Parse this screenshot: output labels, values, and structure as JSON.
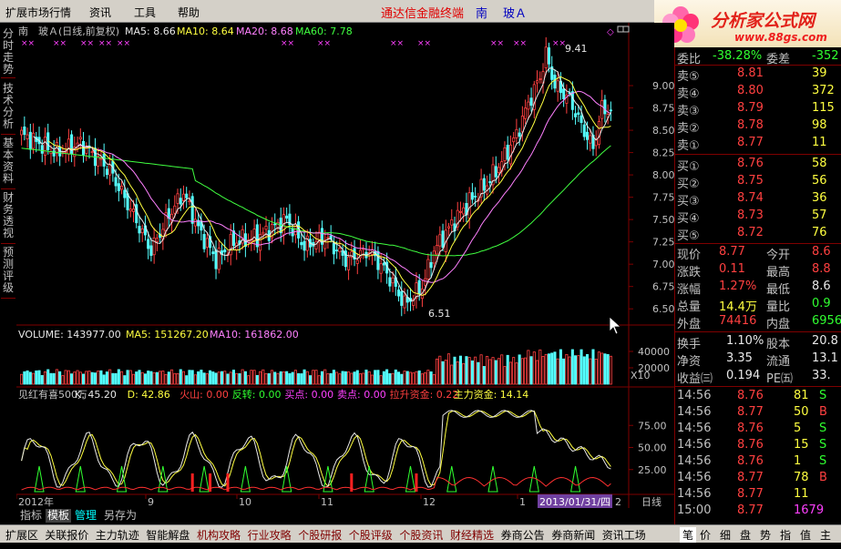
{
  "menubar": {
    "items": [
      "扩展市场行情",
      "资讯",
      "工具",
      "帮助"
    ],
    "title_main": "通达信金融终端",
    "title_market": "南",
    "title_stock": "玻Ａ",
    "window_controls": [
      "_",
      "□",
      "×"
    ]
  },
  "logo": {
    "text": "分析家公式网",
    "url": "www.88gs.com"
  },
  "left_tabs": [
    "分时走势",
    "技术分析",
    "基本资料",
    "财务透视",
    "预测评级"
  ],
  "main_chart": {
    "title": "南　玻Ａ(日线,前复权)",
    "ma": [
      {
        "label": "MA5: 8.66",
        "color": "#e8e8e8"
      },
      {
        "label": "MA10: 8.64",
        "color": "#ffff40"
      },
      {
        "label": "MA20: 8.68",
        "color": "#ff80ff"
      },
      {
        "label": "MA60: 7.78",
        "color": "#40ff40"
      }
    ],
    "high_label": "9.41",
    "low_label": "6.51",
    "y_ticks": [
      "9.00",
      "8.75",
      "8.50",
      "8.25",
      "8.00",
      "7.75",
      "7.50",
      "7.25",
      "7.00",
      "6.75",
      "6.50"
    ]
  },
  "volume": {
    "label": "VOLUME: 143977.00",
    "ma5": "MA5: 151267.20",
    "ma10": "MA10: 161862.00",
    "y_ticks": [
      "40000",
      "20000"
    ],
    "unit": "X10"
  },
  "indicator": {
    "name": "见红有喜500万",
    "items": [
      {
        "label": "K: 45.20",
        "color": "#e8e8e8"
      },
      {
        "label": "D: 42.86",
        "color": "#ffff40"
      },
      {
        "label": "火山: 0.00",
        "color": "#ff4040"
      },
      {
        "label": "反转: 0.00",
        "color": "#30ff30"
      },
      {
        "label": "买点: 0.00",
        "color": "#ff40ff"
      },
      {
        "label": "卖点: 0.00",
        "color": "#ff40ff"
      },
      {
        "label": "拉升资金: 0.22",
        "color": "#ff4040"
      },
      {
        "label": "主力资金: 14.14",
        "color": "#ffff40"
      }
    ],
    "y_ticks": [
      "75.00",
      "50.00",
      "25.00"
    ]
  },
  "x_axis": {
    "labels": [
      "2012年",
      "9",
      "10",
      "11",
      "12",
      "1"
    ],
    "cursor_date": "2013/01/31/四",
    "last": "2",
    "period": "日线"
  },
  "toolbar1": {
    "items": [
      "指标",
      "模板",
      "管理",
      "另存为"
    ]
  },
  "bottom_tabs": [
    "扩展区",
    "关联报价",
    "主力轨迹",
    "智能解盘",
    "机构攻略",
    "行业攻略",
    "个股研报",
    "个股评级",
    "个股资讯",
    "财经精选",
    "券商公告",
    "券商新闻",
    "资讯工场"
  ],
  "side_tabs": [
    "笔",
    "价",
    "细",
    "盘",
    "势",
    "指",
    "值",
    "主"
  ],
  "quote": {
    "header": {
      "weibi_label": "委比",
      "weibi_value": "-38.28%",
      "weicha_label": "委差",
      "weicha_value": "-352"
    },
    "sells": [
      {
        "label": "卖⑤",
        "price": "8.81",
        "vol": "39"
      },
      {
        "label": "卖④",
        "price": "8.80",
        "vol": "372"
      },
      {
        "label": "卖③",
        "price": "8.79",
        "vol": "115"
      },
      {
        "label": "卖②",
        "price": "8.78",
        "vol": "98"
      },
      {
        "label": "卖①",
        "price": "8.77",
        "vol": "11"
      }
    ],
    "buys": [
      {
        "label": "买①",
        "price": "8.76",
        "vol": "58"
      },
      {
        "label": "买②",
        "price": "8.75",
        "vol": "56"
      },
      {
        "label": "买③",
        "price": "8.74",
        "vol": "36"
      },
      {
        "label": "买④",
        "price": "8.73",
        "vol": "57"
      },
      {
        "label": "买⑤",
        "price": "8.72",
        "vol": "76"
      }
    ],
    "stats": [
      {
        "l1": "现价",
        "v1": "8.77",
        "c1": "red",
        "l2": "今开",
        "v2": "8.6",
        "c2": "red"
      },
      {
        "l1": "涨跌",
        "v1": "0.11",
        "c1": "red",
        "l2": "最高",
        "v2": "8.8",
        "c2": "red"
      },
      {
        "l1": "涨幅",
        "v1": "1.27%",
        "c1": "red",
        "l2": "最低",
        "v2": "8.6",
        "c2": "white"
      },
      {
        "l1": "总量",
        "v1": "14.4万",
        "c1": "yellow",
        "l2": "量比",
        "v2": "0.9",
        "c2": "green"
      },
      {
        "l1": "外盘",
        "v1": "74416",
        "c1": "red",
        "l2": "内盘",
        "v2": "6956",
        "c2": "green"
      }
    ],
    "stats2": [
      {
        "l1": "换手",
        "v1": "1.10%",
        "l2": "股本",
        "v2": "20.8"
      },
      {
        "l1": "净资",
        "v1": "3.35",
        "l2": "流通",
        "v2": "13.1"
      },
      {
        "l1": "收益㈢",
        "v1": "0.194",
        "l2": "PE㈤",
        "v2": "33."
      }
    ],
    "ticks": [
      {
        "time": "14:56",
        "price": "8.76",
        "vol": "81",
        "side": "S",
        "vc": "yellow",
        "sc": "green"
      },
      {
        "time": "14:56",
        "price": "8.77",
        "vol": "50",
        "side": "B",
        "vc": "yellow",
        "sc": "red"
      },
      {
        "time": "14:56",
        "price": "8.76",
        "vol": "5",
        "side": "S",
        "vc": "yellow",
        "sc": "green"
      },
      {
        "time": "14:56",
        "price": "8.76",
        "vol": "15",
        "side": "S",
        "vc": "yellow",
        "sc": "green"
      },
      {
        "time": "14:56",
        "price": "8.76",
        "vol": "1",
        "side": "S",
        "vc": "yellow",
        "sc": "green"
      },
      {
        "time": "14:56",
        "price": "8.77",
        "vol": "78",
        "side": "B",
        "vc": "yellow",
        "sc": "red"
      },
      {
        "time": "14:56",
        "price": "8.77",
        "vol": "11",
        "side": "",
        "vc": "yellow",
        "sc": "white"
      },
      {
        "time": "15:00",
        "price": "8.77",
        "vol": "1679",
        "side": "",
        "vc": "mag",
        "sc": "white"
      }
    ]
  }
}
